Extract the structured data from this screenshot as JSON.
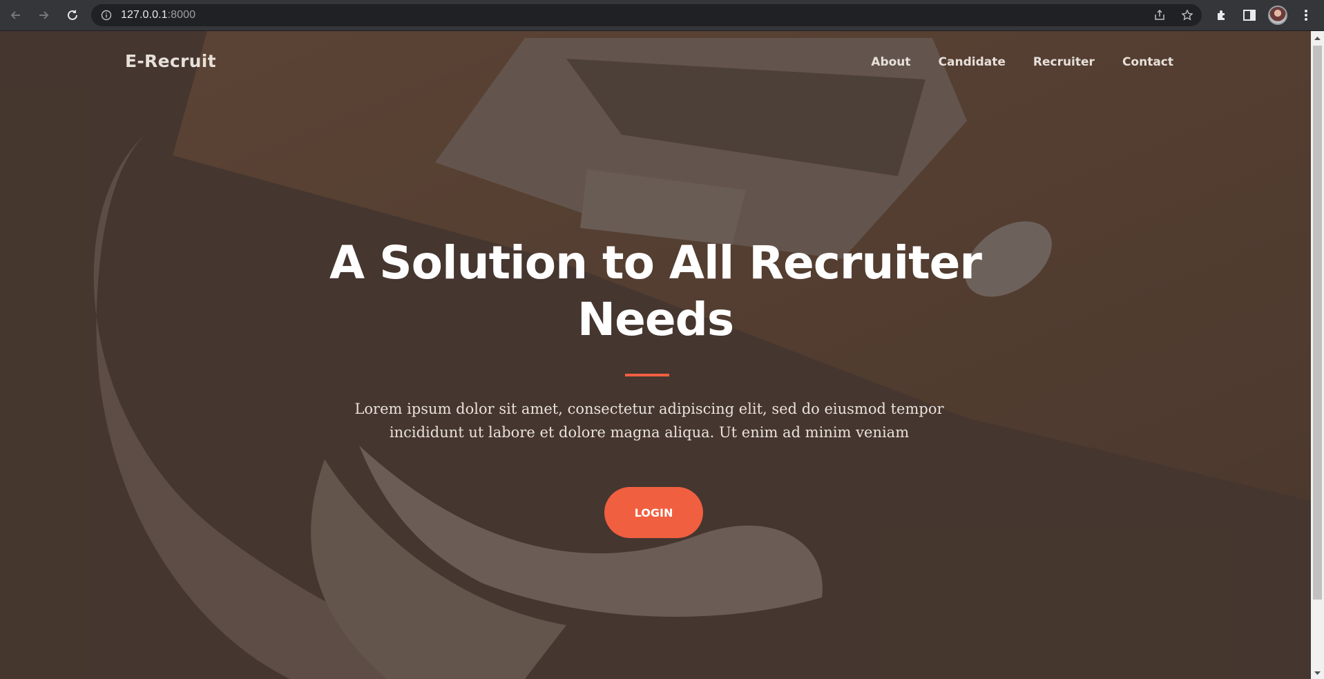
{
  "browser": {
    "url_host": "127.0.0.1",
    "url_port": ":8000"
  },
  "nav": {
    "brand": "E-Recruit",
    "items": [
      {
        "label": "About"
      },
      {
        "label": "Candidate"
      },
      {
        "label": "Recruiter"
      },
      {
        "label": "Contact"
      }
    ]
  },
  "hero": {
    "title_line1": "A Solution to All Recruiter",
    "title_line2": "Needs",
    "lead_line1": "Lorem ipsum dolor sit amet, consectetur adipiscing elit, sed do eiusmod tempor",
    "lead_line2": "incididunt ut labore et dolore magna aliqua. Ut enim ad minim veniam",
    "button_label": "LOGIN"
  },
  "colors": {
    "accent": "#f05f40",
    "overlay": "#4c3f37"
  }
}
